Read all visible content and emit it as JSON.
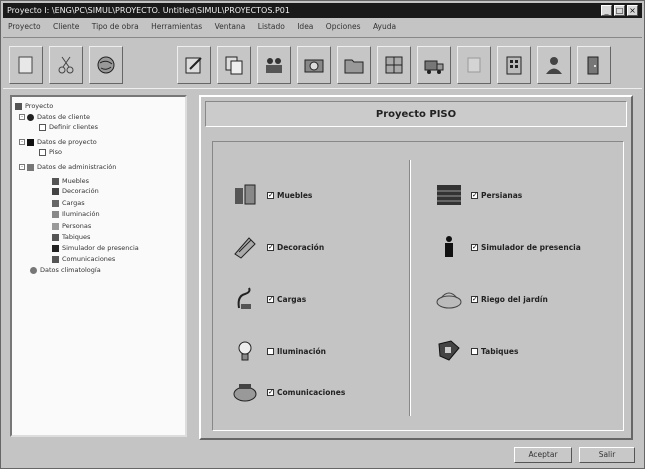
{
  "window": {
    "title": "Proyecto  I: \\ENG\\PC\\SIMUL\\PROYECTO.  Untitled\\SIMUL\\PROYECTOS.P01",
    "min_glyph": "_",
    "max_glyph": "□",
    "close_glyph": "×"
  },
  "menu": [
    "Proyecto",
    "Cliente",
    "Tipo de obra",
    "Herramientas",
    "Ventana",
    "Listado",
    "Idea",
    "Opciones",
    "Ayuda"
  ],
  "toolbar": {
    "icons": [
      "new-icon",
      "cut-icon",
      "globe-icon",
      "edit-icon",
      "copy-icon",
      "people-icon",
      "camera-icon",
      "folder-icon",
      "plan-icon",
      "truck-icon",
      "blank-icon",
      "building-icon",
      "user-icon",
      "exit-icon"
    ]
  },
  "tree": {
    "items": [
      {
        "text": "Proyecto",
        "level": 0,
        "expand": "",
        "icon": "project-icon"
      },
      {
        "text": "Datos de cliente",
        "level": 1,
        "expand": "-",
        "icon": "person-icon"
      },
      {
        "text": "Definir clientes",
        "level": 2,
        "expand": "",
        "icon": "doc-icon"
      },
      {
        "text": "Datos de proyecto",
        "level": 1,
        "expand": "-",
        "icon": "building-icon"
      },
      {
        "text": "Piso",
        "level": 2,
        "expand": "",
        "icon": "doc-icon"
      },
      {
        "text": "Datos de administración",
        "level": 1,
        "expand": "-",
        "icon": "folder-icon"
      },
      {
        "text": "Muebles",
        "level": 2,
        "expand": "",
        "icon": "item-icon"
      },
      {
        "text": "Decoración",
        "level": 2,
        "expand": "",
        "icon": "item-icon"
      },
      {
        "text": "Cargas",
        "level": 2,
        "expand": "",
        "icon": "item-icon"
      },
      {
        "text": "Iluminación",
        "level": 2,
        "expand": "",
        "icon": "item-icon"
      },
      {
        "text": "Personas",
        "level": 2,
        "expand": "",
        "icon": "item-icon"
      },
      {
        "text": "Tabiques",
        "level": 2,
        "expand": "",
        "icon": "item-icon"
      },
      {
        "text": "Simulador de presencia",
        "level": 2,
        "expand": "",
        "icon": "item-icon"
      },
      {
        "text": "Comunicaciones",
        "level": 2,
        "expand": "",
        "icon": "item-icon"
      },
      {
        "text": "Datos climatología",
        "level": 1,
        "expand": "",
        "icon": "cloud-icon"
      }
    ]
  },
  "panel": {
    "title": "Proyecto PISO",
    "left_options": [
      {
        "label": "Muebles",
        "checked": true,
        "icon": "furniture-icon"
      },
      {
        "label": "Decoración",
        "checked": true,
        "icon": "decoration-icon"
      },
      {
        "label": "Cargas",
        "checked": true,
        "icon": "load-icon"
      },
      {
        "label": "Iluminación",
        "checked": false,
        "icon": "lamp-icon"
      },
      {
        "label": "Comunicaciones",
        "checked": true,
        "icon": "phone-icon"
      }
    ],
    "right_options": [
      {
        "label": "Persianas",
        "checked": true,
        "icon": "blind-icon"
      },
      {
        "label": "Simulador de presencia",
        "checked": true,
        "icon": "figure-icon"
      },
      {
        "label": "Riego del jardín",
        "checked": true,
        "icon": "sprinkler-icon"
      },
      {
        "label": "Tabiques",
        "checked": false,
        "icon": "wall-icon"
      }
    ]
  },
  "buttons": {
    "accept": "Aceptar",
    "exit": "Salir"
  }
}
